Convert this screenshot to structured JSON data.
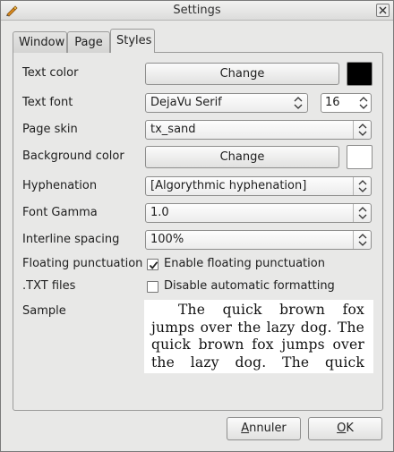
{
  "window": {
    "title": "Settings"
  },
  "tabs": [
    {
      "label": "Window"
    },
    {
      "label": "Page"
    },
    {
      "label": "Styles"
    }
  ],
  "styles": {
    "text_color": {
      "label": "Text color",
      "button": "Change",
      "color": "#000000"
    },
    "text_font": {
      "label": "Text font",
      "value": "DejaVu Serif",
      "size": "16"
    },
    "page_skin": {
      "label": "Page skin",
      "value": "tx_sand"
    },
    "background_color": {
      "label": "Background color",
      "button": "Change",
      "color": "#ffffff"
    },
    "hyphenation": {
      "label": "Hyphenation",
      "value": "[Algorythmic hyphenation]"
    },
    "font_gamma": {
      "label": "Font Gamma",
      "value": "1.0"
    },
    "interline_spacing": {
      "label": "Interline spacing",
      "value": "100%"
    },
    "floating_punctuation": {
      "label": "Floating punctuation",
      "checkbox_label": "Enable floating punctuation",
      "checked": true
    },
    "txt_files": {
      "label": ".TXT files",
      "checkbox_label": "Disable automatic formatting",
      "checked": false
    },
    "sample": {
      "label": "Sample",
      "text": "The quick brown fox jumps over the lazy dog. The quick brown fox jumps over the lazy dog. The quick brown fox jumps over the lazy dog."
    }
  },
  "buttons": {
    "cancel": "Annuler",
    "ok": "OK"
  }
}
